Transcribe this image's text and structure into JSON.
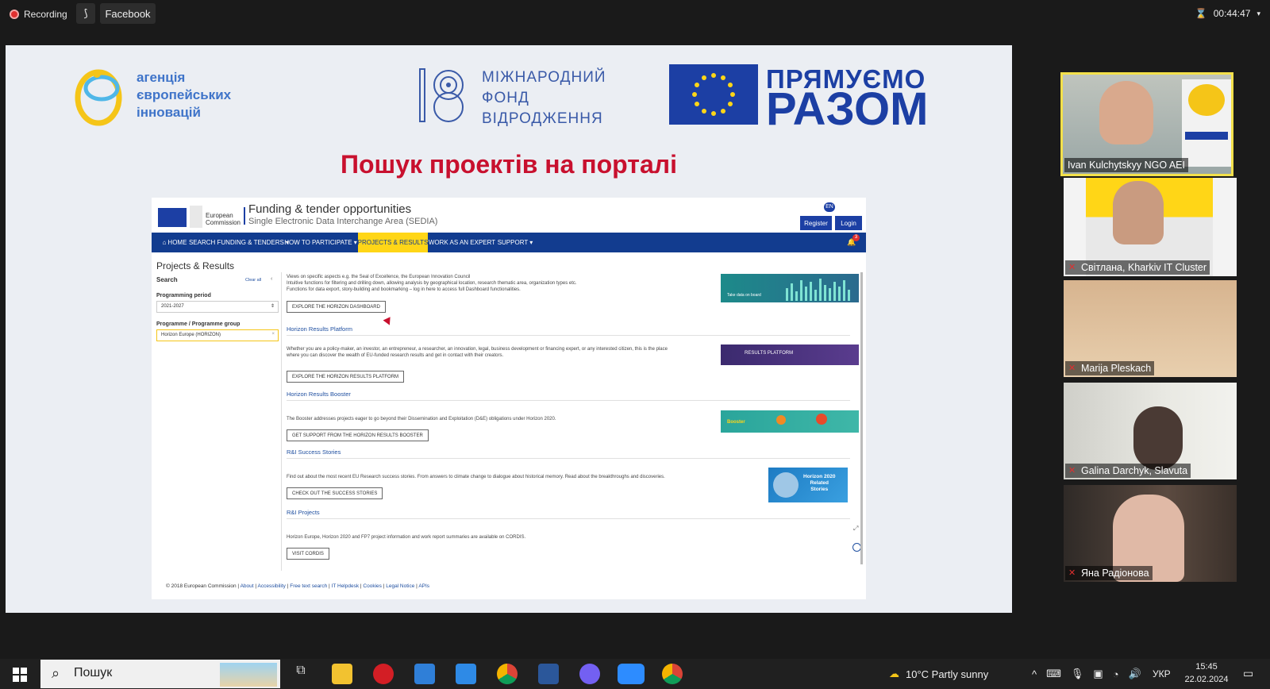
{
  "topbar": {
    "recording_label": "Recording",
    "facebook_label": "Facebook",
    "timer": "00:44:47"
  },
  "slide": {
    "logo_agency": [
      "агенція",
      "європейських",
      "інновацій"
    ],
    "logo_fund": [
      "МІЖНАРОДНИЙ",
      "ФОНД",
      "ВІДРОДЖЕННЯ"
    ],
    "logo_together": [
      "ПРЯМУЄМО",
      "РАЗОМ"
    ],
    "title": "Пошук проектів на порталі"
  },
  "portal": {
    "eu_name": [
      "European",
      "Commission"
    ],
    "title": "Funding & tender opportunities",
    "subtitle": "Single Electronic Data Interchange Area (SEDIA)",
    "lang": "EN",
    "register": "Register",
    "login": "Login",
    "nav": [
      "HOME",
      "SEARCH FUNDING & TENDERS ▾",
      "HOW TO PARTICIPATE ▾",
      "PROJECTS & RESULTS",
      "WORK AS AN EXPERT",
      "SUPPORT ▾"
    ],
    "notif_count": "3",
    "page_heading": "Projects & Results",
    "search_label": "Search",
    "clear_all": "Clear all",
    "prog_period_label": "Programming period",
    "prog_period_value": "2021-2027",
    "prog_group_label": "Programme / Programme group",
    "prog_group_value": "Horizon Europe (HORIZON)",
    "dash_text": [
      "Views on specific aspects e.g. the Seal of Excellence, the European Innovation Council",
      "Intuitive functions for filtering and drilling down, allowing analysis by geographical location, research thematic area, organization types etc.",
      "Functions for data export, story-building and bookmarking – log in here to access full Dashboard functionalities."
    ],
    "btn_dashboard": "EXPLORE THE HORIZON DASHBOARD",
    "link_results_platform": "Horizon Results Platform",
    "results_platform_text": [
      "Whether you are a policy-maker, an investor, an entrepreneur, a researcher, an innovation, legal, business development or financing expert, or any interested citizen, this is the place",
      "where you can discover the wealth of EU-funded research results and get in contact with their creators."
    ],
    "btn_results_platform": "EXPLORE THE HORIZON RESULTS PLATFORM",
    "link_booster": "Horizon Results Booster",
    "booster_text": "The Booster addresses projects eager to go beyond their Dissemination and Exploitation (D&E) obligations under Horizon 2020.",
    "btn_booster": "GET SUPPORT FROM THE HORIZON RESULTS BOOSTER",
    "link_success": "R&I Success Stories",
    "success_text": "Find out about the most recent EU Research success stories. From answers to climate change to dialogue about historical memory. Read about the breakthroughs and discoveries.",
    "btn_success": "CHECK OUT THE SUCCESS STORIES",
    "link_projects": "R&I Projects",
    "projects_text": "Horizon Europe, Horizon 2020 and FP7 project information and work report summaries are available on CORDIS.",
    "btn_cordis": "VISIT CORDIS",
    "thumb_dashboard": "Take data on board",
    "thumb_results_platform": "RESULTS PLATFORM",
    "thumb_booster": "Booster",
    "thumb_stories": [
      "Horizon 2020",
      "Related",
      "Stories"
    ],
    "footer": {
      "copyright": "© 2018 European Commission",
      "links": [
        "About",
        "Accessibility",
        "Free text search",
        "IT Helpdesk",
        "Cookies",
        "Legal Notice",
        "APIs"
      ]
    }
  },
  "participants": [
    {
      "name": "Ivan Kulchytskyy NGO AEI",
      "muted": false
    },
    {
      "name": "Світлана, Kharkiv IT Cluster",
      "muted": true
    },
    {
      "name": "Marija Pleskach",
      "muted": true
    },
    {
      "name": "Galina Darchyk, Slavuta",
      "muted": true
    },
    {
      "name": "Яна Радіонова",
      "muted": true
    }
  ],
  "taskbar": {
    "search_label": "Пошук",
    "weather": "10°C  Partly sunny",
    "lang": "УКР",
    "time": "15:45",
    "date": "22.02.2024"
  },
  "colors": {
    "recording": "#e02f2f",
    "slide_title": "#c8102e",
    "eu_blue": "#1c3fa4",
    "portal_nav": "#123c8f",
    "portal_active": "#ffd617",
    "speaker_border": "#f3e04b"
  }
}
